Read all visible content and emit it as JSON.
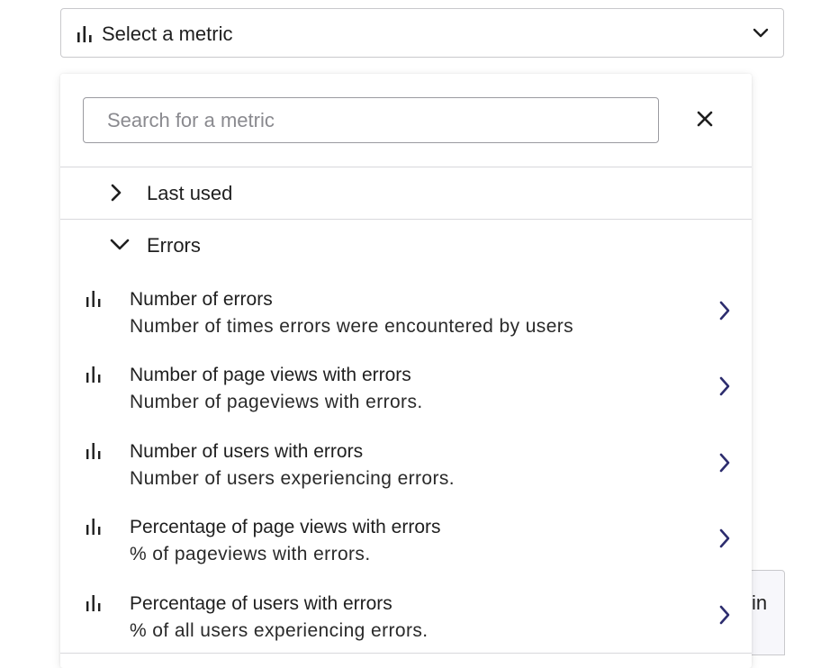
{
  "select": {
    "label": "Select a metric",
    "icon": "bar-chart-icon",
    "chevron": "chevron-down-icon"
  },
  "search": {
    "placeholder": "Search for a metric",
    "value": ""
  },
  "groups": [
    {
      "label": "Last used",
      "expanded": false
    },
    {
      "label": "Errors",
      "expanded": true
    }
  ],
  "metrics": [
    {
      "title": "Number of errors",
      "description": "Number of times errors were encountered by users"
    },
    {
      "title": "Number of page views with errors",
      "description": "Number of pageviews with errors."
    },
    {
      "title": "Number of users with errors",
      "description": "Number of users experiencing errors."
    },
    {
      "title": "Percentage of page views with errors",
      "description": "% of pageviews with errors."
    },
    {
      "title": "Percentage of users with errors",
      "description": "% of all users experiencing errors."
    }
  ],
  "background_button": {
    "label_fragment": "in"
  },
  "colors": {
    "accent_arrow": "#2d2d6e",
    "border": "#c9c9cc",
    "text": "#1f1f1f"
  }
}
